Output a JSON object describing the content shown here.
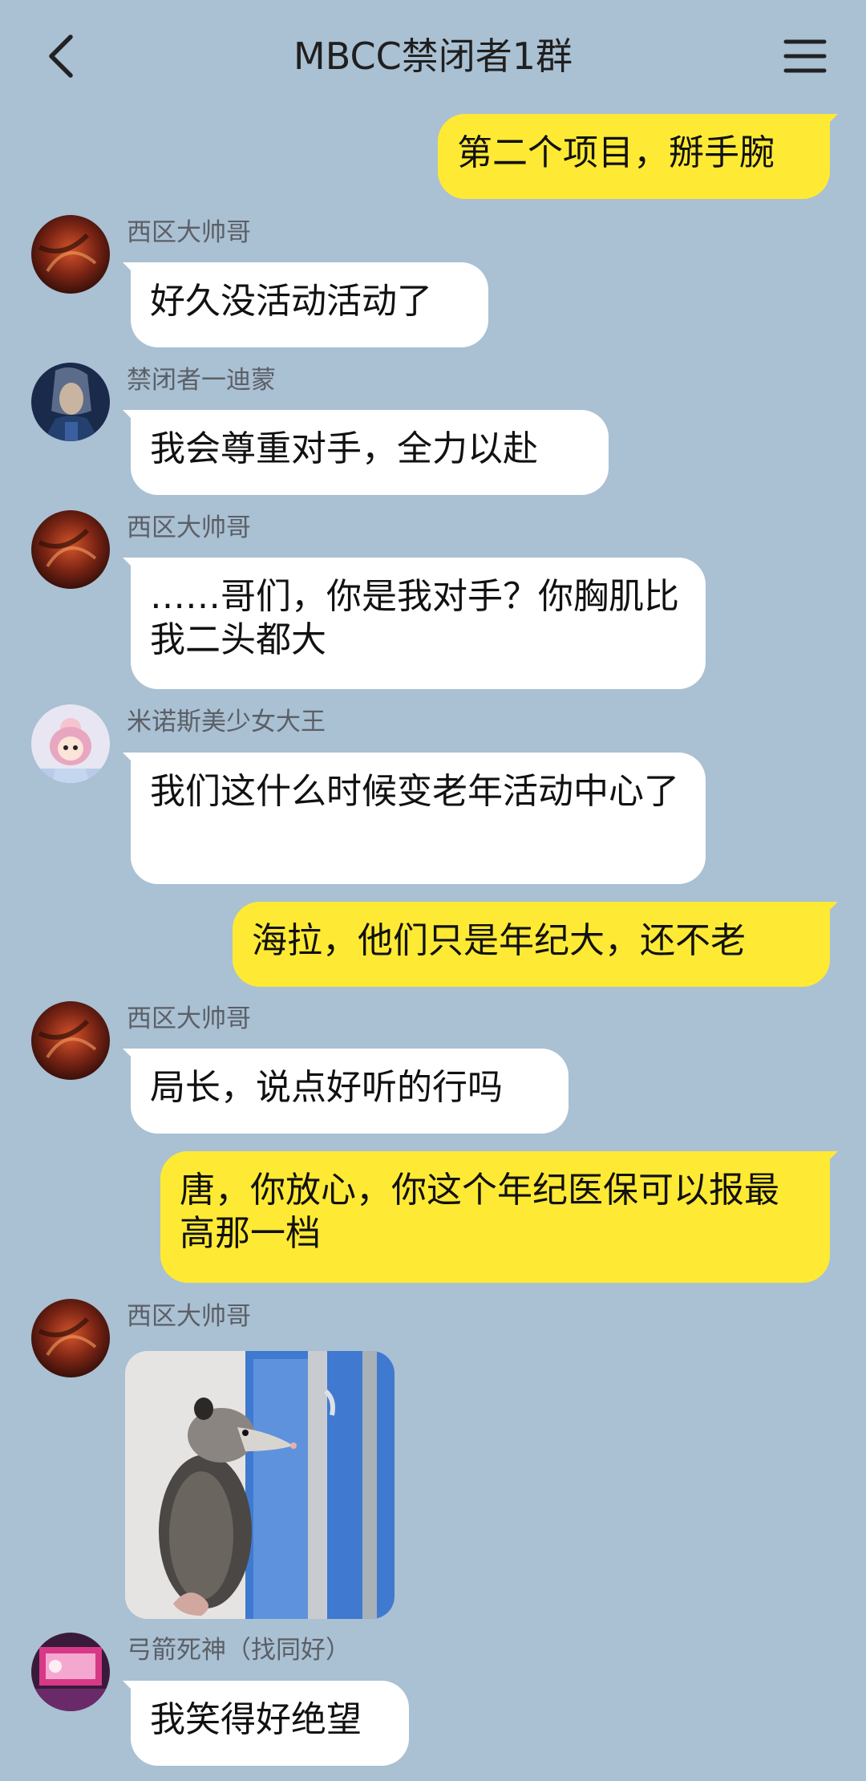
{
  "header": {
    "title": "MBCC禁闭者1群",
    "back_icon": "chevron-left-icon",
    "menu_icon": "hamburger-menu-icon"
  },
  "messages": [
    {
      "side": "right",
      "text": "第二个项目，掰手腕"
    },
    {
      "side": "left",
      "sender": "西区大帅哥",
      "text": "好久没活动活动了"
    },
    {
      "side": "left",
      "sender": "禁闭者一迪蒙",
      "text": "我会尊重对手，全力以赴"
    },
    {
      "side": "left",
      "sender": "西区大帅哥",
      "text": "……哥们，你是我对手？你胸肌比我二头都大"
    },
    {
      "side": "left",
      "sender": "米诺斯美少女大王",
      "text": "我们这什么时候变老年活动中心了"
    },
    {
      "side": "right",
      "text": "海拉，他们只是年纪大，还不老"
    },
    {
      "side": "left",
      "sender": "西区大帅哥",
      "text": "局长，说点好听的行吗"
    },
    {
      "side": "right",
      "text": "唐，你放心，你这个年纪医保可以报最高那一档"
    },
    {
      "side": "left",
      "sender": "西区大帅哥",
      "type": "image",
      "image_icon": "opossum-sticker"
    },
    {
      "side": "left",
      "sender": "弓箭死神（找同好）",
      "text": "我笑得好绝望"
    }
  ],
  "colors": {
    "background": "#aac0d3",
    "self_bubble": "#feea34",
    "other_bubble": "#ffffff",
    "sender_name": "#5b5f66"
  }
}
